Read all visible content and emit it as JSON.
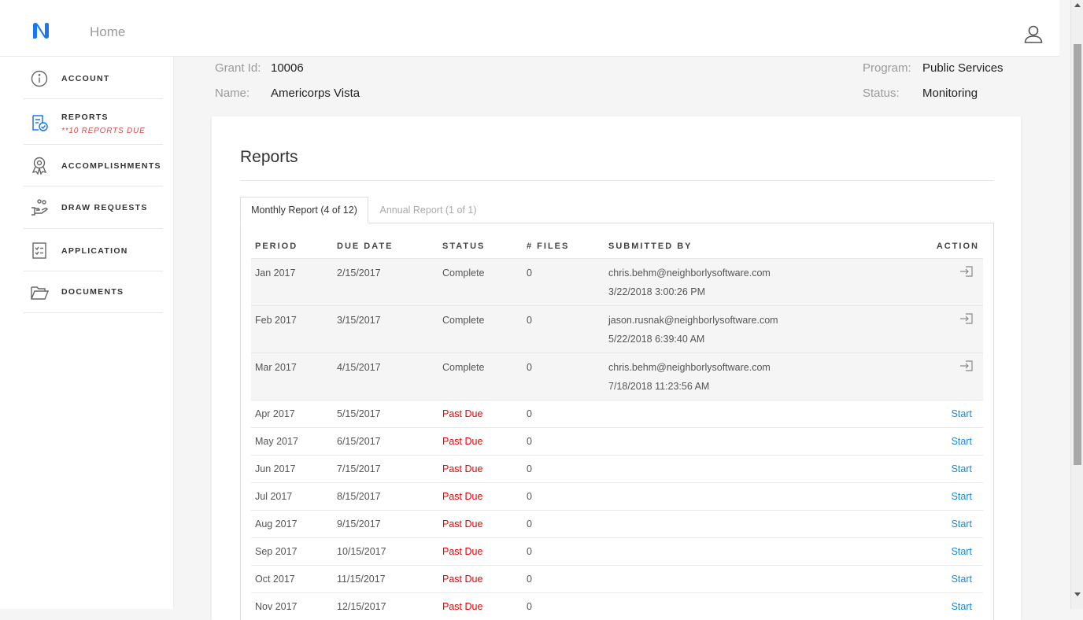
{
  "header": {
    "home_label": "Home"
  },
  "sidebar": {
    "items": [
      {
        "label": "ACCOUNT",
        "icon": "info-icon"
      },
      {
        "label": "REPORTS",
        "sub": "**10 REPORTS DUE",
        "icon": "reports-icon"
      },
      {
        "label": "ACCOMPLISHMENTS",
        "icon": "award-icon"
      },
      {
        "label": "DRAW REQUESTS",
        "icon": "hand-coins-icon"
      },
      {
        "label": "APPLICATION",
        "icon": "checklist-icon"
      },
      {
        "label": "DOCUMENTS",
        "icon": "folder-icon"
      }
    ]
  },
  "grant": {
    "id_label": "Grant Id:",
    "id_value": "10006",
    "name_label": "Name:",
    "name_value": "Americorps Vista",
    "program_label": "Program:",
    "program_value": "Public Services",
    "status_label": "Status:",
    "status_value": "Monitoring"
  },
  "reports": {
    "title": "Reports",
    "tabs": [
      {
        "label": "Monthly Report (4 of 12)",
        "active": true
      },
      {
        "label": "Annual Report (1 of 1)",
        "active": false
      }
    ],
    "columns": [
      "PERIOD",
      "DUE DATE",
      "STATUS",
      "# FILES",
      "SUBMITTED BY",
      "ACTION"
    ],
    "rows": [
      {
        "period": "Jan 2017",
        "due": "2/15/2017",
        "status": "Complete",
        "files": "0",
        "by": "chris.behm@neighborlysoftware.com",
        "when": "3/22/2018 3:00:26 PM",
        "action": ""
      },
      {
        "period": "Feb 2017",
        "due": "3/15/2017",
        "status": "Complete",
        "files": "0",
        "by": "jason.rusnak@neighborlysoftware.com",
        "when": "5/22/2018 6:39:40 AM",
        "action": ""
      },
      {
        "period": "Mar 2017",
        "due": "4/15/2017",
        "status": "Complete",
        "files": "0",
        "by": "chris.behm@neighborlysoftware.com",
        "when": "7/18/2018 11:23:56 AM",
        "action": ""
      },
      {
        "period": "Apr 2017",
        "due": "5/15/2017",
        "status": "Past Due",
        "files": "0",
        "by": "",
        "when": "",
        "action": "Start"
      },
      {
        "period": "May 2017",
        "due": "6/15/2017",
        "status": "Past Due",
        "files": "0",
        "by": "",
        "when": "",
        "action": "Start"
      },
      {
        "period": "Jun 2017",
        "due": "7/15/2017",
        "status": "Past Due",
        "files": "0",
        "by": "",
        "when": "",
        "action": "Start"
      },
      {
        "period": "Jul 2017",
        "due": "8/15/2017",
        "status": "Past Due",
        "files": "0",
        "by": "",
        "when": "",
        "action": "Start"
      },
      {
        "period": "Aug 2017",
        "due": "9/15/2017",
        "status": "Past Due",
        "files": "0",
        "by": "",
        "when": "",
        "action": "Start"
      },
      {
        "period": "Sep 2017",
        "due": "10/15/2017",
        "status": "Past Due",
        "files": "0",
        "by": "",
        "when": "",
        "action": "Start"
      },
      {
        "period": "Oct 2017",
        "due": "11/15/2017",
        "status": "Past Due",
        "files": "0",
        "by": "",
        "when": "",
        "action": "Start"
      },
      {
        "period": "Nov 2017",
        "due": "12/15/2017",
        "status": "Past Due",
        "files": "0",
        "by": "",
        "when": "",
        "action": "Start"
      }
    ]
  },
  "colors": {
    "accent": "#1a8ad8",
    "past_due": "#e00000",
    "reports_due": "#e04747",
    "logo": "#1877f2"
  }
}
